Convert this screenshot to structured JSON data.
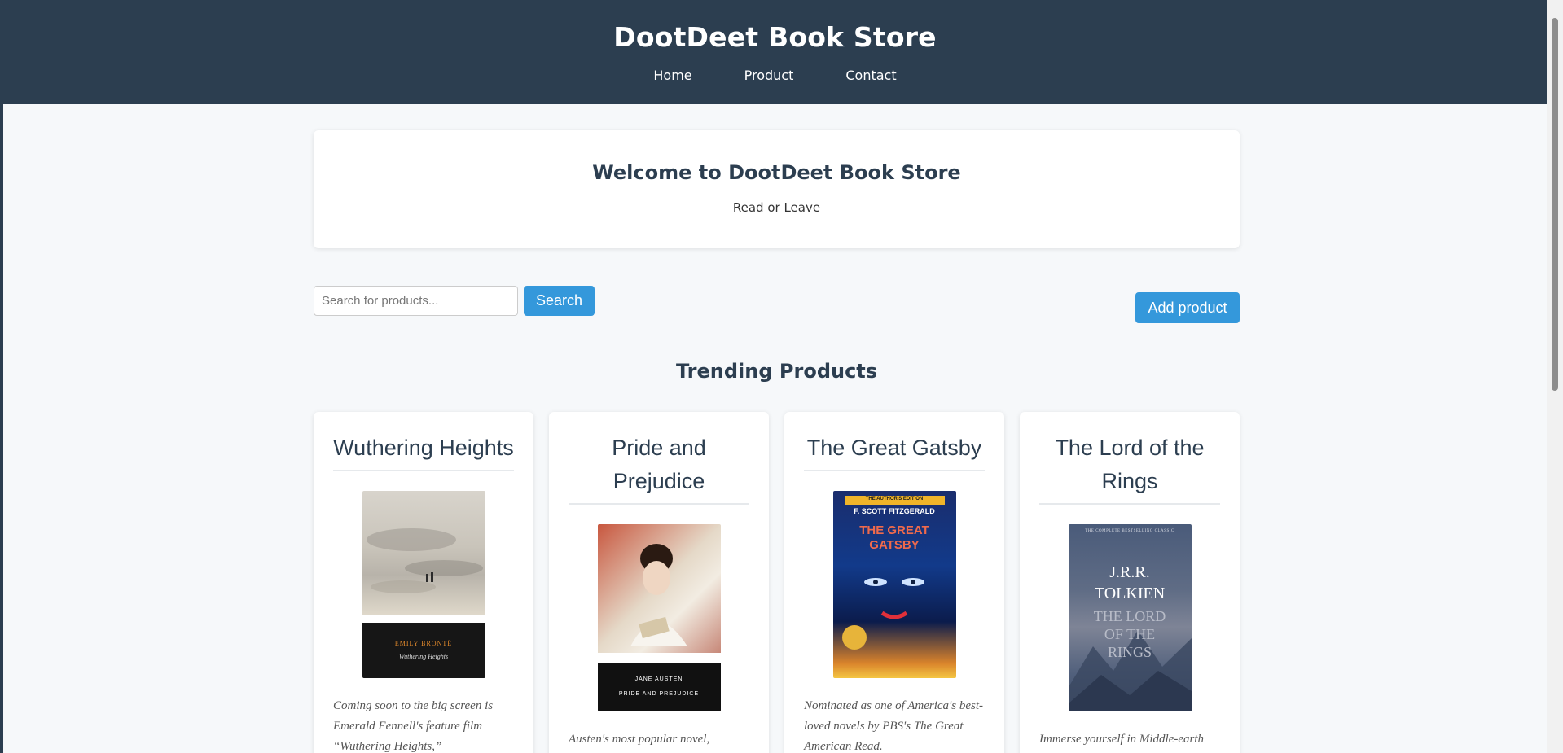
{
  "header": {
    "site_title": "DootDeet Book Store",
    "nav": [
      "Home",
      "Product",
      "Contact"
    ]
  },
  "welcome": {
    "title": "Welcome to DootDeet Book Store",
    "tagline": "Read or Leave"
  },
  "search": {
    "placeholder": "Search for products...",
    "value": "",
    "button_label": "Search"
  },
  "add_product_label": "Add product",
  "section_title": "Trending Products",
  "products": [
    {
      "title": "Wuthering Heights",
      "cover_author": "EMILY BRONTË",
      "cover_title": "Wuthering Heights",
      "description": "Coming soon to the big screen is Emerald Fennell's feature film “Wuthering Heights,”"
    },
    {
      "title": "Pride and Prejudice",
      "cover_author": "JANE AUSTEN",
      "cover_title": "PRIDE AND PREJUDICE",
      "description": "Austen's most popular novel,"
    },
    {
      "title": "The Great Gatsby",
      "cover_top": "THE AUTHOR'S EDITION",
      "cover_author": "F. SCOTT FITZGERALD",
      "cover_title": "THE GREAT GATSBY",
      "description": "Nominated as one of America's best-loved novels by PBS's The Great American Read."
    },
    {
      "title": "The Lord of the Rings",
      "cover_top": "THE COMPLETE BESTSELLING CLASSIC",
      "cover_author": "J.R.R. TOLKIEN",
      "cover_title": "THE LORD OF THE RINGS",
      "description": "Immerse yourself in Middle-earth with J.R.R. Tolkien's classic"
    }
  ],
  "colors": {
    "header_bg": "#2c3e50",
    "accent": "#3498db",
    "page_bg": "#f6f8fa"
  }
}
